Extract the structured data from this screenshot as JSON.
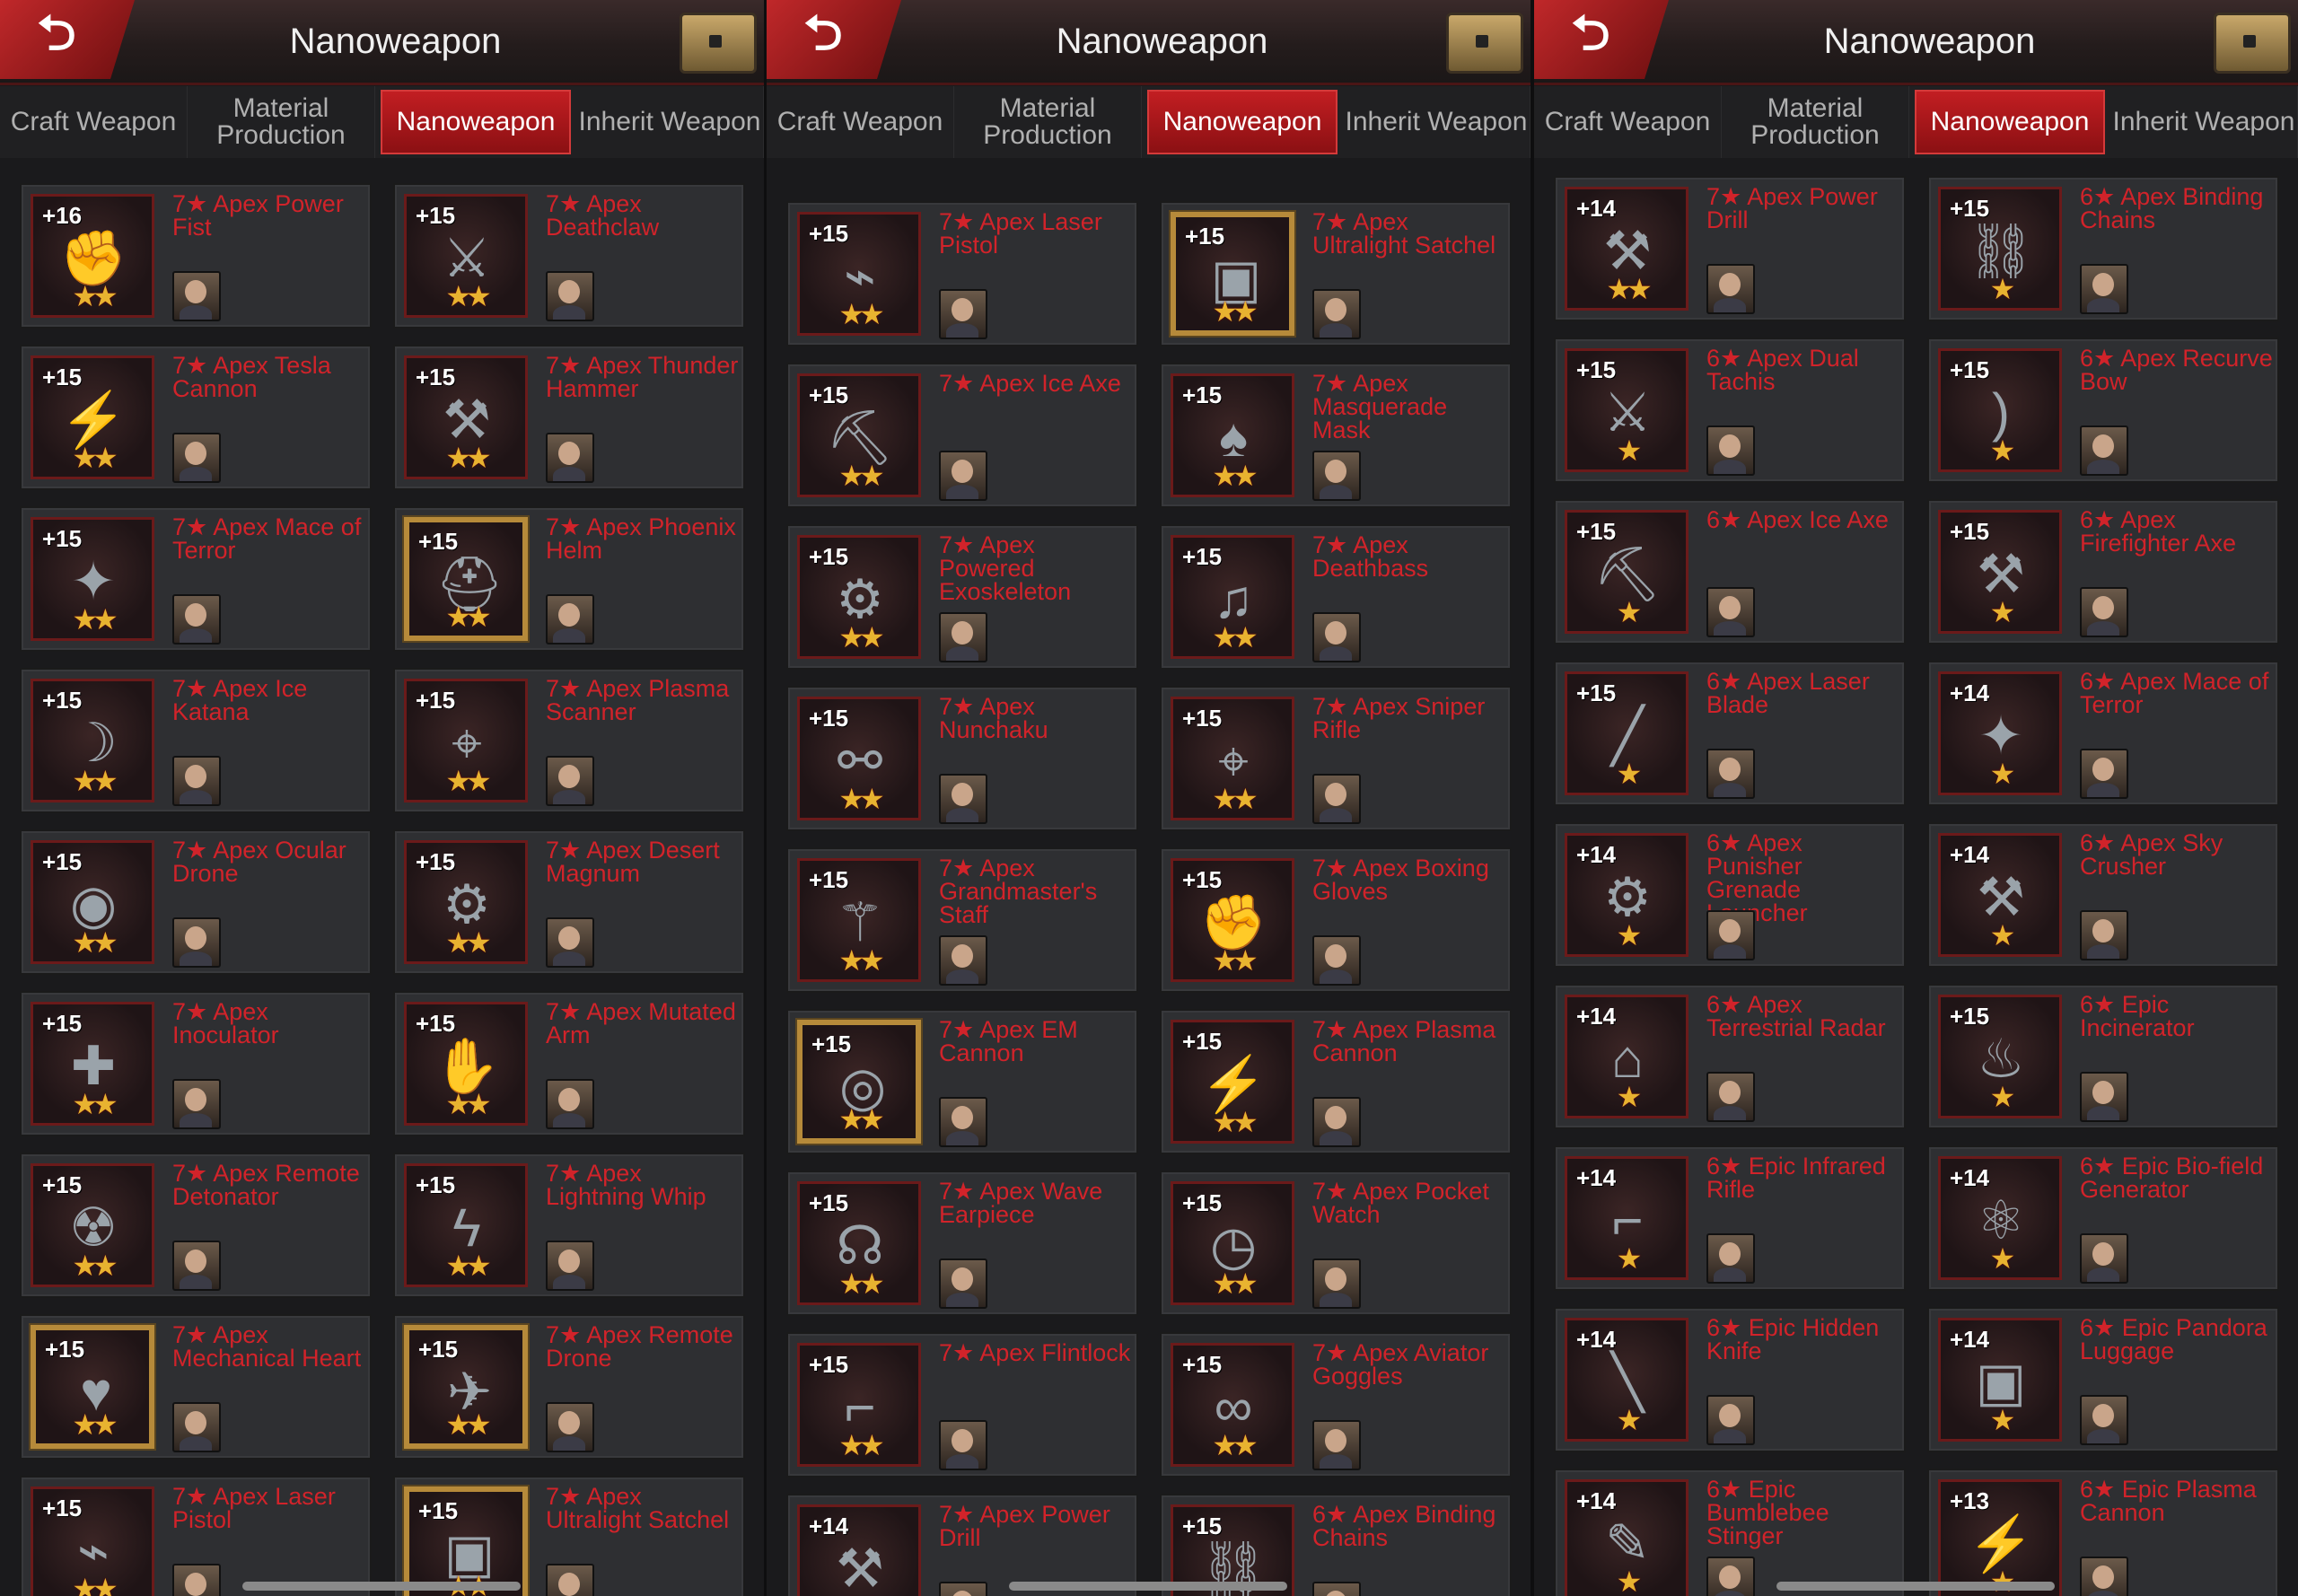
{
  "panels": [
    {
      "title": "Nanoweapon",
      "tabs": [
        "Craft Weapon",
        "Material Production",
        "Nanoweapon",
        "Inherit Weapon"
      ],
      "active_tab": 2,
      "items": [
        {
          "level": "+16",
          "name": "7★ Apex Power Fist",
          "stars": "★★",
          "glyph": "✊"
        },
        {
          "level": "+15",
          "name": "7★ Apex Deathclaw",
          "stars": "★★",
          "glyph": "⚔"
        },
        {
          "level": "+15",
          "name": "7★ Apex Tesla Cannon",
          "stars": "★★",
          "glyph": "⚡"
        },
        {
          "level": "+15",
          "name": "7★ Apex Thunder Hammer",
          "stars": "★★",
          "glyph": "⚒"
        },
        {
          "level": "+15",
          "name": "7★ Apex Mace of Terror",
          "stars": "★★",
          "glyph": "✦"
        },
        {
          "level": "+15",
          "name": "7★ Apex Phoenix Helm",
          "stars": "★★",
          "glyph": "⛑",
          "gold": true
        },
        {
          "level": "+15",
          "name": "7★ Apex Ice Katana",
          "stars": "★★",
          "glyph": "☽"
        },
        {
          "level": "+15",
          "name": "7★ Apex Plasma Scanner",
          "stars": "★★",
          "glyph": "⌖"
        },
        {
          "level": "+15",
          "name": "7★ Apex Ocular Drone",
          "stars": "★★",
          "glyph": "◉"
        },
        {
          "level": "+15",
          "name": "7★ Apex Desert Magnum",
          "stars": "★★",
          "glyph": "⚙"
        },
        {
          "level": "+15",
          "name": "7★ Apex Inoculator",
          "stars": "★★",
          "glyph": "✚"
        },
        {
          "level": "+15",
          "name": "7★ Apex Mutated Arm",
          "stars": "★★",
          "glyph": "✋"
        },
        {
          "level": "+15",
          "name": "7★ Apex Remote Detonator",
          "stars": "★★",
          "glyph": "☢"
        },
        {
          "level": "+15",
          "name": "7★ Apex Lightning Whip",
          "stars": "★★",
          "glyph": "ϟ"
        },
        {
          "level": "+15",
          "name": "7★ Apex Mechanical Heart",
          "stars": "★★",
          "glyph": "♥",
          "gold": true
        },
        {
          "level": "+15",
          "name": "7★ Apex Remote Drone",
          "stars": "★★",
          "glyph": "✈",
          "gold": true
        },
        {
          "level": "+15",
          "name": "7★ Apex Laser Pistol",
          "stars": "★★",
          "glyph": "⌁"
        },
        {
          "level": "+15",
          "name": "7★ Apex Ultralight Satchel",
          "stars": "★★",
          "glyph": "▣",
          "gold": true
        }
      ]
    },
    {
      "title": "Nanoweapon",
      "tabs": [
        "Craft Weapon",
        "Material Production",
        "Nanoweapon",
        "Inherit Weapon"
      ],
      "active_tab": 2,
      "items": [
        {
          "level": "+15",
          "name": "7★ Apex Laser Pistol",
          "stars": "★★",
          "glyph": "⌁"
        },
        {
          "level": "+15",
          "name": "7★ Apex Ultralight Satchel",
          "stars": "★★",
          "glyph": "▣",
          "gold": true
        },
        {
          "level": "+15",
          "name": "7★ Apex Ice Axe",
          "stars": "★★",
          "glyph": "⛏"
        },
        {
          "level": "+15",
          "name": "7★ Apex Masquerade Mask",
          "stars": "★★",
          "glyph": "♠"
        },
        {
          "level": "+15",
          "name": "7★ Apex Powered Exoskeleton",
          "stars": "★★",
          "glyph": "⚙"
        },
        {
          "level": "+15",
          "name": "7★ Apex Deathbass",
          "stars": "★★",
          "glyph": "♫"
        },
        {
          "level": "+15",
          "name": "7★ Apex Nunchaku",
          "stars": "★★",
          "glyph": "⚯"
        },
        {
          "level": "+15",
          "name": "7★ Apex Sniper Rifle",
          "stars": "★★",
          "glyph": "⌖"
        },
        {
          "level": "+15",
          "name": "7★ Apex Grandmaster's Staff",
          "stars": "★★",
          "glyph": "⚚"
        },
        {
          "level": "+15",
          "name": "7★ Apex Boxing Gloves",
          "stars": "★★",
          "glyph": "✊"
        },
        {
          "level": "+15",
          "name": "7★ Apex EM Cannon",
          "stars": "★★",
          "glyph": "◎",
          "gold": true
        },
        {
          "level": "+15",
          "name": "7★ Apex Plasma Cannon",
          "stars": "★★",
          "glyph": "⚡"
        },
        {
          "level": "+15",
          "name": "7★ Apex Wave Earpiece",
          "stars": "★★",
          "glyph": "☊"
        },
        {
          "level": "+15",
          "name": "7★ Apex Pocket Watch",
          "stars": "★★",
          "glyph": "◷"
        },
        {
          "level": "+15",
          "name": "7★ Apex Flintlock",
          "stars": "★★",
          "glyph": "⌐"
        },
        {
          "level": "+15",
          "name": "7★ Apex Aviator Goggles",
          "stars": "★★",
          "glyph": "∞"
        },
        {
          "level": "+14",
          "name": "7★ Apex Power Drill",
          "stars": "★★",
          "glyph": "⚒"
        },
        {
          "level": "+15",
          "name": "6★ Apex Binding Chains",
          "stars": "★",
          "glyph": "⛓"
        }
      ]
    },
    {
      "title": "Nanoweapon",
      "tabs": [
        "Craft Weapon",
        "Material Production",
        "Nanoweapon",
        "Inherit Weapon"
      ],
      "active_tab": 2,
      "items": [
        {
          "level": "+14",
          "name": "7★ Apex Power Drill",
          "stars": "★★",
          "glyph": "⚒"
        },
        {
          "level": "+15",
          "name": "6★ Apex Binding Chains",
          "stars": "★",
          "glyph": "⛓"
        },
        {
          "level": "+15",
          "name": "6★ Apex Dual Tachis",
          "stars": "★",
          "glyph": "⚔"
        },
        {
          "level": "+15",
          "name": "6★ Apex Recurve Bow",
          "stars": "★",
          "glyph": ")"
        },
        {
          "level": "+15",
          "name": "6★ Apex Ice Axe",
          "stars": "★",
          "glyph": "⛏"
        },
        {
          "level": "+15",
          "name": "6★ Apex Firefighter Axe",
          "stars": "★",
          "glyph": "⚒"
        },
        {
          "level": "+15",
          "name": "6★ Apex Laser Blade",
          "stars": "★",
          "glyph": "╱"
        },
        {
          "level": "+14",
          "name": "6★ Apex Mace of Terror",
          "stars": "★",
          "glyph": "✦"
        },
        {
          "level": "+14",
          "name": "6★ Apex Punisher Grenade Launcher",
          "stars": "★",
          "glyph": "⚙"
        },
        {
          "level": "+14",
          "name": "6★ Apex Sky Crusher",
          "stars": "★",
          "glyph": "⚒"
        },
        {
          "level": "+14",
          "name": "6★ Apex Terrestrial Radar",
          "stars": "★",
          "glyph": "⌂"
        },
        {
          "level": "+15",
          "name": "6★ Epic Incinerator",
          "stars": "★",
          "glyph": "♨"
        },
        {
          "level": "+14",
          "name": "6★ Epic Infrared Rifle",
          "stars": "★",
          "glyph": "⌐"
        },
        {
          "level": "+14",
          "name": "6★ Epic Bio-field Generator",
          "stars": "★",
          "glyph": "⚛"
        },
        {
          "level": "+14",
          "name": "6★ Epic Hidden Knife",
          "stars": "★",
          "glyph": "╲"
        },
        {
          "level": "+14",
          "name": "6★ Epic Pandora Luggage",
          "stars": "★",
          "glyph": "▣"
        },
        {
          "level": "+14",
          "name": "6★ Epic Bumblebee Stinger",
          "stars": "★",
          "glyph": "✎"
        },
        {
          "level": "+13",
          "name": "6★ Epic Plasma Cannon",
          "stars": "★",
          "glyph": "⚡"
        }
      ]
    }
  ],
  "back_glyph": "⮌"
}
